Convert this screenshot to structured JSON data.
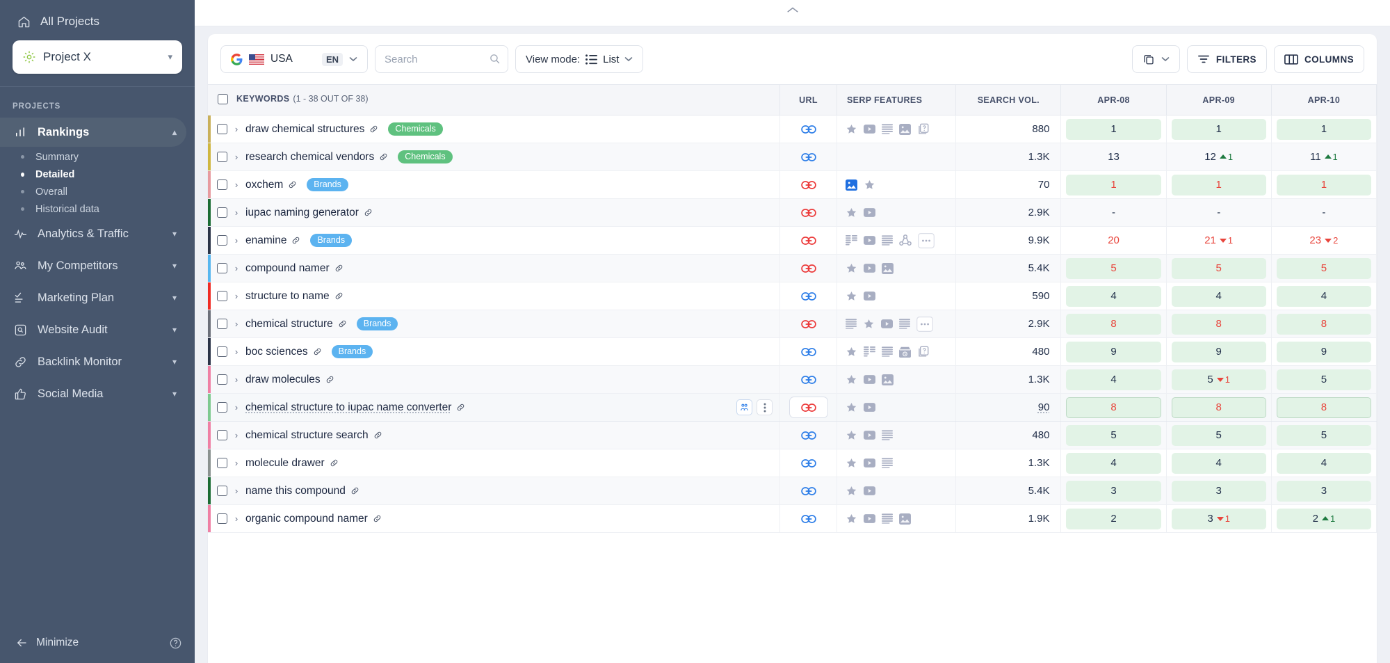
{
  "sidebar": {
    "all_projects_label": "All Projects",
    "project_name": "Project X",
    "section_label": "PROJECTS",
    "items": [
      {
        "label": "Rankings",
        "icon": "bar-chart-icon",
        "expanded": true
      },
      {
        "label": "Analytics & Traffic",
        "icon": "pulse-icon",
        "expanded": false
      },
      {
        "label": "My Competitors",
        "icon": "people-icon",
        "expanded": false
      },
      {
        "label": "Marketing Plan",
        "icon": "checklist-icon",
        "expanded": false
      },
      {
        "label": "Website Audit",
        "icon": "magnifier-box-icon",
        "expanded": false
      },
      {
        "label": "Backlink Monitor",
        "icon": "link-icon",
        "expanded": false
      },
      {
        "label": "Social Media",
        "icon": "thumbs-up-icon",
        "expanded": false
      }
    ],
    "rankings_sub": [
      {
        "label": "Summary",
        "current": false
      },
      {
        "label": "Detailed",
        "current": true
      },
      {
        "label": "Overall",
        "current": false
      },
      {
        "label": "Historical data",
        "current": false
      }
    ],
    "minimize_label": "Minimize",
    "help_icon": "help-circle-icon"
  },
  "toolbar": {
    "search_engine_icon": "google-icon",
    "country_flag": "usa-flag-icon",
    "country": "USA",
    "language": "EN",
    "search_placeholder": "Search",
    "search_value": "",
    "view_mode_label": "View mode:",
    "view_mode_value": "List",
    "copy_label": "",
    "filters_label": "FILTERS",
    "columns_label": "COLUMNS"
  },
  "table": {
    "headers": {
      "keywords": "KEYWORDS",
      "keywords_count": "(1 - 38 OUT OF 38)",
      "url": "URL",
      "serp_features": "SERP FEATURES",
      "search_vol": "SEARCH VOL.",
      "date1": "APR-08",
      "date2": "APR-09",
      "date3": "APR-10"
    },
    "rows": [
      {
        "keyword": "draw chemical structures",
        "tag": "Chemicals",
        "tag_kind": "chem",
        "bar": "#c9b05a",
        "url_color": "blue",
        "serp": [
          "star",
          "video",
          "list",
          "image",
          "cards"
        ],
        "volume": "880",
        "r1": {
          "v": "1",
          "red": false,
          "bg": true
        },
        "r2": {
          "v": "1",
          "red": false,
          "bg": true
        },
        "r3": {
          "v": "1",
          "red": false,
          "bg": true
        }
      },
      {
        "keyword": "research chemical vendors",
        "tag": "Chemicals",
        "tag_kind": "chem",
        "bar": "#cfb63f",
        "url_color": "blue",
        "serp": [],
        "volume": "1.3K",
        "r1": {
          "v": "13",
          "red": false,
          "bg": false
        },
        "r2": {
          "v": "12",
          "red": false,
          "bg": false,
          "delta": "1",
          "dir": "up"
        },
        "r3": {
          "v": "11",
          "red": false,
          "bg": false,
          "delta": "1",
          "dir": "up"
        }
      },
      {
        "keyword": "oxchem",
        "tag": "Brands",
        "tag_kind": "brand",
        "bar": "#e79a9f",
        "url_color": "red",
        "serp": [
          "image-blue",
          "star"
        ],
        "volume": "70",
        "r1": {
          "v": "1",
          "red": true,
          "bg": true
        },
        "r2": {
          "v": "1",
          "red": true,
          "bg": true
        },
        "r3": {
          "v": "1",
          "red": true,
          "bg": true
        }
      },
      {
        "keyword": "iupac naming generator",
        "tag": "",
        "tag_kind": "",
        "bar": "#1a6b33",
        "url_color": "red",
        "serp": [
          "star",
          "video"
        ],
        "volume": "2.9K",
        "r1": {
          "v": "-",
          "red": false,
          "bg": false
        },
        "r2": {
          "v": "-",
          "red": false,
          "bg": false
        },
        "r3": {
          "v": "-",
          "red": false,
          "bg": false
        }
      },
      {
        "keyword": "enamine",
        "tag": "Brands",
        "tag_kind": "brand",
        "bar": "#2a3347",
        "url_color": "red",
        "serp": [
          "snippet",
          "video",
          "list",
          "graph",
          "more"
        ],
        "volume": "9.9K",
        "r1": {
          "v": "20",
          "red": true,
          "bg": false
        },
        "r2": {
          "v": "21",
          "red": true,
          "bg": false,
          "delta": "1",
          "dir": "down"
        },
        "r3": {
          "v": "23",
          "red": true,
          "bg": false,
          "delta": "2",
          "dir": "down"
        }
      },
      {
        "keyword": "compound namer",
        "tag": "",
        "tag_kind": "",
        "bar": "#56b6ef",
        "url_color": "red",
        "serp": [
          "star",
          "video",
          "image"
        ],
        "volume": "5.4K",
        "r1": {
          "v": "5",
          "red": true,
          "bg": true
        },
        "r2": {
          "v": "5",
          "red": true,
          "bg": true
        },
        "r3": {
          "v": "5",
          "red": true,
          "bg": true
        }
      },
      {
        "keyword": "structure to name",
        "tag": "",
        "tag_kind": "",
        "bar": "#ef2b24",
        "url_color": "blue",
        "serp": [
          "star",
          "video"
        ],
        "volume": "590",
        "r1": {
          "v": "4",
          "red": false,
          "bg": true
        },
        "r2": {
          "v": "4",
          "red": false,
          "bg": true
        },
        "r3": {
          "v": "4",
          "red": false,
          "bg": true
        }
      },
      {
        "keyword": "chemical structure",
        "tag": "Brands",
        "tag_kind": "brand",
        "bar": "#6b6f79",
        "url_color": "red",
        "serp": [
          "list",
          "star",
          "video",
          "list",
          "more"
        ],
        "volume": "2.9K",
        "r1": {
          "v": "8",
          "red": true,
          "bg": true
        },
        "r2": {
          "v": "8",
          "red": true,
          "bg": true
        },
        "r3": {
          "v": "8",
          "red": true,
          "bg": true
        }
      },
      {
        "keyword": "boc sciences",
        "tag": "Brands",
        "tag_kind": "brand",
        "bar": "#2a3347",
        "url_color": "blue",
        "serp": [
          "star",
          "snippet",
          "list",
          "shop",
          "cards"
        ],
        "volume": "480",
        "r1": {
          "v": "9",
          "red": false,
          "bg": true
        },
        "r2": {
          "v": "9",
          "red": false,
          "bg": true
        },
        "r3": {
          "v": "9",
          "red": false,
          "bg": true
        }
      },
      {
        "keyword": "draw molecules",
        "tag": "",
        "tag_kind": "",
        "bar": "#ef7fa4",
        "url_color": "blue",
        "serp": [
          "star",
          "video",
          "image"
        ],
        "volume": "1.3K",
        "r1": {
          "v": "4",
          "red": false,
          "bg": true
        },
        "r2": {
          "v": "5",
          "red": false,
          "bg": true,
          "delta": "1",
          "dir": "down"
        },
        "r3": {
          "v": "5",
          "red": false,
          "bg": true
        }
      },
      {
        "keyword": "chemical structure to iupac name converter",
        "tag": "",
        "tag_kind": "",
        "bar": "#7ec98f",
        "url_color": "red",
        "serp": [
          "star",
          "video"
        ],
        "volume": "90",
        "volume_dotted": true,
        "highlight": true,
        "keyword_dotted": true,
        "r1": {
          "v": "8",
          "red": true,
          "bg": true
        },
        "r2": {
          "v": "8",
          "red": true,
          "bg": true
        },
        "r3": {
          "v": "8",
          "red": true,
          "bg": true
        }
      },
      {
        "keyword": "chemical structure search",
        "tag": "",
        "tag_kind": "",
        "bar": "#ef7fa4",
        "url_color": "blue",
        "serp": [
          "star",
          "video",
          "list"
        ],
        "volume": "480",
        "r1": {
          "v": "5",
          "red": false,
          "bg": true
        },
        "r2": {
          "v": "5",
          "red": false,
          "bg": true
        },
        "r3": {
          "v": "5",
          "red": false,
          "bg": true
        }
      },
      {
        "keyword": "molecule drawer",
        "tag": "",
        "tag_kind": "",
        "bar": "#8a9190",
        "url_color": "blue",
        "serp": [
          "star",
          "video",
          "list"
        ],
        "volume": "1.3K",
        "r1": {
          "v": "4",
          "red": false,
          "bg": true
        },
        "r2": {
          "v": "4",
          "red": false,
          "bg": true
        },
        "r3": {
          "v": "4",
          "red": false,
          "bg": true
        }
      },
      {
        "keyword": "name this compound",
        "tag": "",
        "tag_kind": "",
        "bar": "#1a6b33",
        "url_color": "blue",
        "serp": [
          "star",
          "video"
        ],
        "volume": "5.4K",
        "r1": {
          "v": "3",
          "red": false,
          "bg": true
        },
        "r2": {
          "v": "3",
          "red": false,
          "bg": true
        },
        "r3": {
          "v": "3",
          "red": false,
          "bg": true
        }
      },
      {
        "keyword": "organic compound namer",
        "tag": "",
        "tag_kind": "",
        "bar": "#ef7fa4",
        "url_color": "blue",
        "serp": [
          "star",
          "video",
          "list",
          "image"
        ],
        "volume": "1.9K",
        "r1": {
          "v": "2",
          "red": false,
          "bg": true
        },
        "r2": {
          "v": "3",
          "red": false,
          "bg": true,
          "delta": "1",
          "dir": "down"
        },
        "r3": {
          "v": "2",
          "red": false,
          "bg": true,
          "delta": "1",
          "dir": "up"
        }
      }
    ]
  },
  "colors": {
    "sidebar_bg": "#47566d",
    "accent_green": "#5fc17f",
    "accent_blue": "#5cb3f0",
    "rank_green_bg": "#e2f3e6",
    "down_red": "#e8453c",
    "up_green": "#1e7a40"
  }
}
